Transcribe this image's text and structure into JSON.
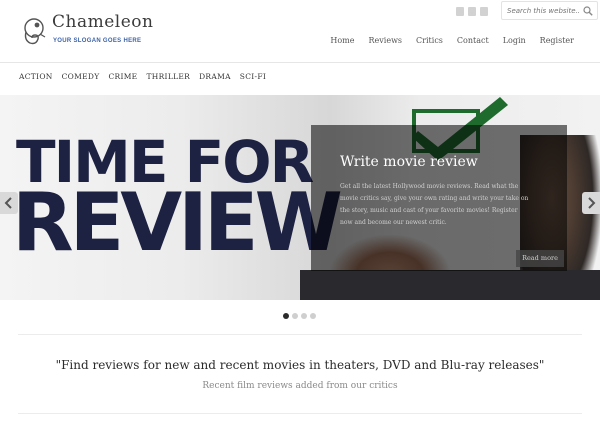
{
  "site": {
    "name": "Chameleon",
    "slogan": "YOUR SLOGAN GOES HERE"
  },
  "social": [
    "twitter-icon",
    "vimeo-icon",
    "facebook-icon"
  ],
  "search": {
    "placeholder": "Search this website...",
    "icon": "search-icon"
  },
  "main_nav": [
    {
      "label": "Home"
    },
    {
      "label": "Reviews"
    },
    {
      "label": "Critics"
    },
    {
      "label": "Contact"
    },
    {
      "label": "Login"
    },
    {
      "label": "Register"
    }
  ],
  "category_nav": [
    {
      "label": "ACTION"
    },
    {
      "label": "COMEDY"
    },
    {
      "label": "CRIME"
    },
    {
      "label": "THRILLER"
    },
    {
      "label": "DRAMA"
    },
    {
      "label": "SCI-FI"
    }
  ],
  "slider": {
    "headline_line1": "TIME FOR",
    "headline_line2": "REVIEW",
    "caption_title": "Write movie review",
    "caption_text": "Get all the latest Hollywood movie reviews. Read what the movie critics say, give your own rating and write your take on the story, music and cast of your favorite movies! Register now and become our newest critic.",
    "read_more": "Read more",
    "prev_icon": "chevron-left-icon",
    "next_icon": "chevron-right-icon",
    "total_slides": 4,
    "active_slide": 1
  },
  "intro": {
    "quote": "\"Find reviews for new and recent movies in theaters, DVD and Blu-ray releases\"",
    "subtitle": "Recent film reviews added from our critics"
  },
  "colors": {
    "headline": "#1d2142",
    "slogan": "#3e63a8",
    "check": "#1f6b2e"
  }
}
